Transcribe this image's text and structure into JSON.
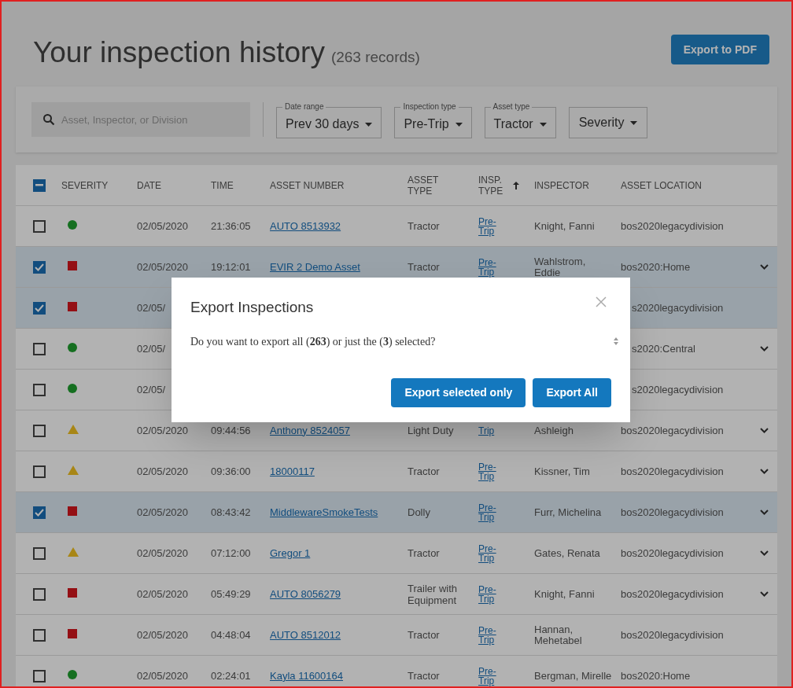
{
  "page": {
    "title": "Your inspection history",
    "record_count": "(263 records)",
    "export_button": "Export to PDF"
  },
  "filters": {
    "search": {
      "placeholder": "Asset, Inspector, or Division"
    },
    "dropdowns": [
      {
        "label": "Date range",
        "value": "Prev 30 days"
      },
      {
        "label": "Inspection type",
        "value": "Pre-Trip"
      },
      {
        "label": "Asset type",
        "value": "Tractor"
      },
      {
        "value": "Severity"
      }
    ]
  },
  "table": {
    "select_all": {
      "indeterminate": true
    },
    "columns": [
      {
        "label": "SEVERITY"
      },
      {
        "label": "DATE"
      },
      {
        "label": "TIME"
      },
      {
        "label": "ASSET NUMBER"
      },
      {
        "label": "ASSET TYPE"
      },
      {
        "label": "INSP. TYPE",
        "sort_ascending": true
      },
      {
        "label": "INSPECTOR"
      },
      {
        "label": "ASSET LOCATION"
      }
    ],
    "rows": [
      {
        "checked": false,
        "severity": {
          "kind": "circle",
          "color": "#156f20"
        },
        "date": "02/05/2020",
        "time": "21:36:05",
        "asset_number": "AUTO 8513932",
        "asset_type": "Tractor",
        "insp_type": "Pre-Trip",
        "inspector": "Knight, Fanni",
        "location": "bos2020legacydivision",
        "expandable": false
      },
      {
        "checked": true,
        "severity": {
          "kind": "square",
          "color": "#940f14"
        },
        "date": "02/05/2020",
        "time": "19:12:01",
        "asset_number": "EVIR 2 Demo Asset",
        "asset_type": "Tractor",
        "insp_type": "Pre-Trip",
        "inspector": "Wahlstrom, Eddie",
        "location": "bos2020:Home",
        "expandable": true
      },
      {
        "checked": true,
        "severity": {
          "kind": "square",
          "color": "#940f14"
        },
        "date": "02/05/",
        "location": "s2020legacydivision",
        "expandable": false
      },
      {
        "checked": false,
        "severity": {
          "kind": "circle",
          "color": "#156f20"
        },
        "date": "02/05/",
        "location": "s2020:Central",
        "expandable": true
      },
      {
        "checked": false,
        "severity": {
          "kind": "circle",
          "color": "#156f20"
        },
        "date": "02/05/",
        "location": "s2020legacydivision",
        "expandable": false
      },
      {
        "checked": false,
        "severity": {
          "kind": "triangle",
          "color": "#a88616"
        },
        "date": "02/05/2020",
        "time": "09:44:56",
        "asset_number": "Anthony 8524057",
        "asset_type": "Light Duty",
        "insp_type": "Trip",
        "inspector": "Ashleigh",
        "location": "bos2020legacydivision",
        "expandable": true
      },
      {
        "checked": false,
        "severity": {
          "kind": "triangle",
          "color": "#a88616"
        },
        "date": "02/05/2020",
        "time": "09:36:00",
        "asset_number": "18000117",
        "asset_type": "Tractor",
        "insp_type": "Pre-Trip",
        "inspector": "Kissner, Tim",
        "location": "bos2020legacydivision",
        "expandable": true
      },
      {
        "checked": true,
        "severity": {
          "kind": "square",
          "color": "#940f14"
        },
        "date": "02/05/2020",
        "time": "08:43:42",
        "asset_number": "MiddlewareSmokeTests",
        "asset_type": "Dolly",
        "insp_type": "Pre-Trip",
        "inspector": "Furr, Michelina",
        "location": "bos2020legacydivision",
        "expandable": true
      },
      {
        "checked": false,
        "severity": {
          "kind": "triangle",
          "color": "#a88616"
        },
        "date": "02/05/2020",
        "time": "07:12:00",
        "asset_number": "Gregor 1",
        "asset_type": "Tractor",
        "insp_type": "Pre-Trip",
        "inspector": "Gates, Renata",
        "location": "bos2020legacydivision",
        "expandable": true
      },
      {
        "checked": false,
        "severity": {
          "kind": "square",
          "color": "#940f14"
        },
        "date": "02/05/2020",
        "time": "05:49:29",
        "asset_number": "AUTO 8056279",
        "asset_type": "Trailer with Equipment",
        "insp_type": "Pre-Trip",
        "inspector": "Knight, Fanni",
        "location": "bos2020legacydivision",
        "expandable": true
      },
      {
        "checked": false,
        "severity": {
          "kind": "square",
          "color": "#940f14"
        },
        "date": "02/05/2020",
        "time": "04:48:04",
        "asset_number": "AUTO 8512012",
        "asset_type": "Tractor",
        "insp_type": "Pre-Trip",
        "inspector": "Hannan, Mehetabel",
        "location": "bos2020legacydivision",
        "expandable": false
      },
      {
        "checked": false,
        "severity": {
          "kind": "circle",
          "color": "#156f20"
        },
        "date": "02/05/2020",
        "time": "02:24:01",
        "asset_number": "Kayla 11600164",
        "asset_type": "Tractor",
        "insp_type": "Pre-Trip",
        "inspector": "Bergman, Mirelle",
        "location": "bos2020:Home",
        "expandable": false
      }
    ]
  },
  "dialog": {
    "title": "Export Inspections",
    "message": "Do you want to export all (**263**) or just the (**3**) selected?",
    "buttons": [
      {
        "label": "Export selected only"
      },
      {
        "label": "Export All"
      }
    ]
  }
}
